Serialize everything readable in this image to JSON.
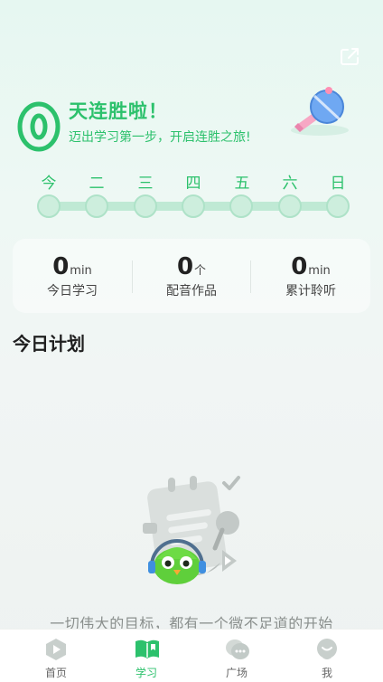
{
  "streak": {
    "title": "天连胜啦！",
    "subtitle": "迈出学习第一步，开启连胜之旅!"
  },
  "week": [
    "今",
    "二",
    "三",
    "四",
    "五",
    "六",
    "日"
  ],
  "stats": [
    {
      "value": "0",
      "unit": "min",
      "label": "今日学习"
    },
    {
      "value": "0",
      "unit": "个",
      "label": "配音作品"
    },
    {
      "value": "0",
      "unit": "min",
      "label": "累计聆听"
    }
  ],
  "plan": {
    "title": "今日计划",
    "empty_text": "一切伟大的目标，都有一个微不足道的开始"
  },
  "tabs": [
    {
      "label": "首页",
      "icon": "play-icon"
    },
    {
      "label": "学习",
      "icon": "book-icon"
    },
    {
      "label": "广场",
      "icon": "chat-bubbles-icon"
    },
    {
      "label": "我",
      "icon": "profile-icon"
    }
  ],
  "colors": {
    "accent": "#2cc16c",
    "track": "#bfe9d4"
  }
}
